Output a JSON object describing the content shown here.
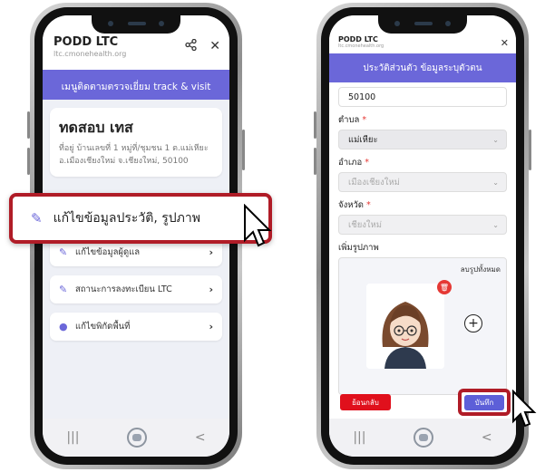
{
  "left": {
    "app_title": "PODD LTC",
    "app_url": "ltc.cmonehealth.org",
    "banner": "เมนูติดตามตรวจเยี่ยม track & visit",
    "patient_name": "ทดสอบ เทส",
    "address_line1": "ที่อยู่ บ้านเลขที่ 1 หมู่ที่/ชุมชน 1 ต.แม่เหียะ",
    "address_line2": "อ.เมืองเชียงใหม่ จ.เชียงใหม่, 50100",
    "highlight_item": "แก้ไขข้อมูลประวัติ, รูปภาพ",
    "menu": [
      {
        "label": "แก้ไขข้อมูลผู้ดูแล"
      },
      {
        "label": "สถานะการลงทะเบียน LTC"
      },
      {
        "label": "แก้ไขพิกัดพื้นที่"
      }
    ]
  },
  "right": {
    "app_title": "PODD LTC",
    "app_url": "ltc.cmonehealth.org",
    "banner": "ประวัติส่วนตัว ข้อมูลระบุตัวตน",
    "postcode": "50100",
    "subdistrict_label": "ตำบล",
    "subdistrict_value": "แม่เหียะ",
    "district_label": "อำเภอ",
    "district_value": "เมืองเชียงใหม่",
    "province_label": "จังหวัด",
    "province_value": "เชียงใหม่",
    "required_mark": "*",
    "photo_label": "เพิ่มรูปภาพ",
    "delete_all": "ลบรูปทั้งหมด",
    "back_button": "ย้อนกลับ",
    "save_button": "บันทึก"
  },
  "nav": {
    "recent": "|||",
    "back": "<"
  },
  "colors": {
    "accent": "#6b67d9",
    "highlight": "#b01c27",
    "danger": "#e0101c"
  }
}
